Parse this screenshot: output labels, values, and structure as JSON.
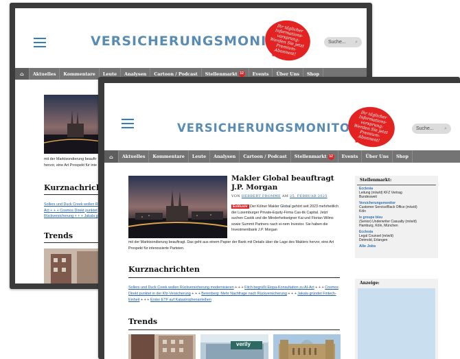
{
  "site": {
    "brand": "VERSICHERUNGSMONITOR",
    "bubble_text": "Ihr täglicher Informations-vorsprung: Werden Sie jetzt Premium-Abonnent!",
    "search_placeholder": "Suche...",
    "nav": [
      "Aktuelles",
      "Kommentare",
      "Leute",
      "Analysen",
      "Cartoon / Podcast",
      "Stellenmarkt",
      "Events",
      "Über Uns",
      "Shop"
    ],
    "stellenmarkt_badge": "12"
  },
  "article": {
    "headline": "Makler Global beauftragt J.P. Morgan",
    "byline_prefix": "VON",
    "author": "HERBERT FROMME",
    "byline_mid": "AM",
    "date": "25. FEBRUAR 2025",
    "badge": "Exklusiv",
    "teaser": "Der Kölner Makler Global gehört seit 2023 mehrheitlich der Luxemburger Private-Equity-Firma Cas-tik Capital. Jetzt suchen Castik und die Minderheitseigner Kai und Florian Wilms sowie Summit Partners nach ei-nem Investor. Sie haben die Investmentbank J.P. Morgan",
    "teaser_continued": "mit der Marktsondierung beauftragt. Das geht aus einem Papier der Bank mit Details über die Lage des Maklers hervor, eine Art Prospekt für interessierte Parteien.",
    "back_teaser_line1": "mit der Marktsondierung beauftr",
    "back_teaser_line2": "hervor, eine Art Prospekt für inte"
  },
  "kurznachrichten": {
    "title": "Kurznachrichten",
    "items": [
      "Sollers und Duck Creek wollen Rückversicherung modernisieren",
      "Fitch begrüßt Eiopa-Konsultation zu AI-Act",
      "Cosmos Direkt punktet in der Kfz-Versicherung",
      "Berenberg: Mehr Nachfrage nach Rückversicherung",
      "Jakala gründet Fintech-Einheit",
      "Erster ETF auf Katastrophenanleihen"
    ],
    "separator": "+ + +",
    "back_line1": "Sollers und Duck Creek wollen R",
    "back_line2": "Act + + + Cosmos Direkt punktet",
    "back_line3": "Rückversicherung + + + Jakala g"
  },
  "trends": {
    "title": "Trends",
    "thumb3_sign": "verily"
  },
  "stellenmarkt": {
    "title": "Stellenmarkt:",
    "jobs": [
      {
        "company": "Ecclesia",
        "position": "Leitung (m/w/d) KFZ Vertrag",
        "location": "Bundesweit"
      },
      {
        "company": "Versicherungsmonitor",
        "position": "Customer Service/Back Office (m/w/d)",
        "location": "Köln"
      },
      {
        "company": "le groupe bleu",
        "position": "(Senior) Underwriter Casualty (m/w/d)",
        "location": "Hamburg, Köln, München"
      },
      {
        "company": "Ecclesia",
        "position": "Legal Counsel (m/w/d)",
        "location": "Detmold, Erlangen"
      }
    ],
    "all_jobs": "Alle Jobs"
  },
  "anzeige": {
    "title": "Anzeige:"
  },
  "colors": {
    "brand": "#5a8cb3",
    "accent_red": "#e32222",
    "nav_gray": "#747474",
    "link_blue": "#1f5fa8"
  }
}
